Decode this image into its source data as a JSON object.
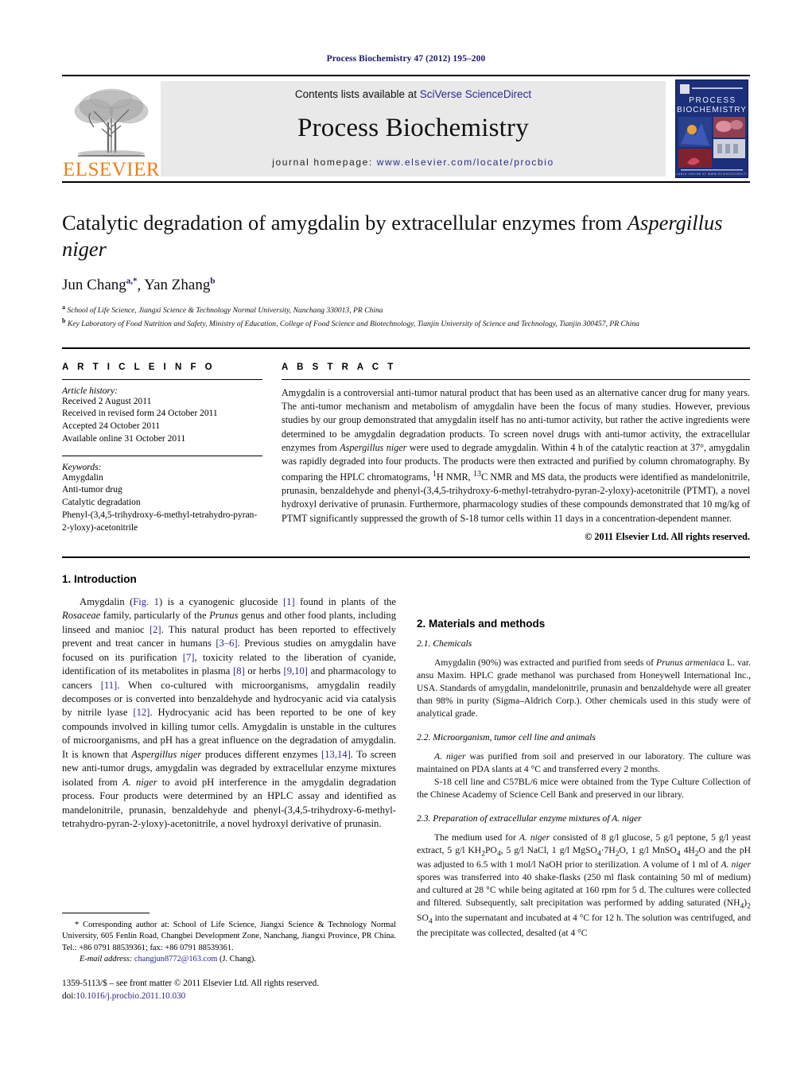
{
  "running_head": "Process Biochemistry 47 (2012) 195–200",
  "masthead": {
    "contents_prefix": "Contents lists available at ",
    "contents_link": "SciVerse ScienceDirect",
    "journal_title": "Process Biochemistry",
    "homepage_prefix": "journal homepage: ",
    "homepage_url": "www.elsevier.com/locate/procbio",
    "publisher_wordmark": "ELSEVIER",
    "publisher_logo_icon": "elsevier-tree-icon",
    "cover_thumb_icon": "journal-cover-thumbnail",
    "cover_title_line1": "PROCESS",
    "cover_title_line2": "BIOCHEMISTRY"
  },
  "article": {
    "title_part1": "Catalytic degradation of amygdalin by extracellular enzymes from ",
    "title_italic": "Aspergillus niger",
    "authors": [
      {
        "name": "Jun Chang",
        "marks": "a,*"
      },
      {
        "name": "Yan Zhang",
        "marks": "b"
      }
    ],
    "affiliations": [
      {
        "mark": "a",
        "text": "School of Life Science, Jiangxi Science & Technology Normal University, Nanchang 330013, PR China"
      },
      {
        "mark": "b",
        "text": "Key Laboratory of Food Nutrition and Safety, Ministry of Education, College of Food Science and Biotechnology, Tianjin University of Science and Technology, Tianjin 300457, PR China"
      }
    ]
  },
  "article_info": {
    "heading": "A R T I C L E  I N F O",
    "history_label": "Article history:",
    "history": [
      "Received 2 August 2011",
      "Received in revised form 24 October 2011",
      "Accepted 24 October 2011",
      "Available online 31 October 2011"
    ],
    "keywords_label": "Keywords:",
    "keywords": [
      "Amygdalin",
      "Anti-tumor drug",
      "Catalytic degradation",
      "Phenyl-(3,4,5-trihydroxy-6-methyl-tetrahydro-pyran-2-yloxy)-acetonitrile"
    ]
  },
  "abstract": {
    "heading": "A B S T R A C T",
    "p1_a": "Amygdalin is a controversial anti-tumor natural product that has been used as an alternative cancer drug for many years. The anti-tumor mechanism and metabolism of amygdalin have been the focus of many studies. However, previous studies by our group demonstrated that amygdalin itself has no anti-tumor activity, but rather the active ingredients were determined to be amygdalin degradation products. To screen novel drugs with anti-tumor activity, the extracellular enzymes from ",
    "p1_italic1": "Aspergillus niger",
    "p1_b": " were used to degrade amygdalin. Within 4 h of the catalytic reaction at 37°, amygdalin was rapidly degraded into four products. The products were then extracted and purified by column chromatography. By comparing the HPLC chromatograms, ",
    "p1_sup1": "1",
    "p1_c": "H NMR, ",
    "p1_sup2": "13",
    "p1_d": "C NMR and MS data, the products were identified as mandelonitrile, prunasin, benzaldehyde and phenyl-(3,4,5-trihydroxy-6-methyl-tetrahydro-pyran-2-yloxy)-acetonitrile (PTMT), a novel hydroxyl derivative of prunasin. Furthermore, pharmacology studies of these compounds demonstrated that 10 mg/kg of PTMT significantly suppressed the growth of S-18 tumor cells within 11 days in a concentration-dependent manner.",
    "copyright": "© 2011 Elsevier Ltd. All rights reserved."
  },
  "sections": {
    "introduction": {
      "number_title": "1.  Introduction",
      "p1_a": "Amygdalin (",
      "p1_figref": "Fig. 1",
      "p1_b": ") is a cyanogenic glucoside ",
      "p1_r1": "[1]",
      "p1_c": " found in plants of the ",
      "p1_i1": "Rosaceae",
      "p1_d": " family, particularly of the ",
      "p1_i2": "Prunus",
      "p1_e": " genus and other food plants, including linseed and manioc ",
      "p1_r2": "[2]",
      "p1_f": ". This natural product has been reported to effectively prevent and treat cancer in humans ",
      "p1_r3": "[3–6]",
      "p1_g": ". Previous studies on amygdalin have focused on its purification ",
      "p1_r4": "[7]",
      "p1_h": ", toxicity related to the liberation of cyanide, identification of its metabolites in plasma ",
      "p1_r5": "[8]",
      "p1_i": " or herbs ",
      "p1_r6": "[9,10]",
      "p1_j": " and pharmacology to cancers ",
      "p1_r7": "[11]",
      "p1_k": ". When co-cultured with microorganisms, amygdalin readily decomposes or is converted into benzaldehyde and hydrocyanic acid via catalysis by nitrile lyase ",
      "p1_r8": "[12]",
      "p1_l": ". Hydrocyanic acid has been reported to be one of key compounds involved in killing tumor cells. Amygdalin is unstable in the cultures of microorganisms, and pH has a great influence on the degradation of amygdalin. It is known that ",
      "p1_i3": "Aspergillus niger",
      "p1_m": " produces different enzymes ",
      "p1_r9": "[13,14]",
      "p1_n": ". To screen new anti-tumor drugs, amygdalin was degraded by extracellular enzyme mixtures isolated from ",
      "p1_i4": "A. niger",
      "p1_o": " to avoid pH interference in the amygdalin degradation process. Four products were determined by an HPLC assay and identified as mandelonitrile, prunasin, benzaldehyde and phenyl-(3,4,5-trihydroxy-6-methyl-tetrahydro-pyran-2-yloxy)-acetonitrile, a novel hydroxyl derivative of prunasin."
    },
    "materials": {
      "number_title": "2.  Materials and methods",
      "sub1_title": "2.1.  Chemicals",
      "sub1_a": "Amygdalin (90%) was extracted and purified from seeds of ",
      "sub1_i1": "Prunus armeniaca",
      "sub1_b": " L. var. ansu Maxim. HPLC grade methanol was purchased from Honeywell International Inc., USA. Standards of amygdalin, mandelonitrile, prunasin and benzaldehyde were all greater than 98% in purity (Sigma–Aldrich Corp.). Other chemicals used in this study were of analytical grade.",
      "sub2_title": "2.2.  Microorganism, tumor cell line and animals",
      "sub2_i1": "A. niger",
      "sub2_a": " was purified from soil and preserved in our laboratory. The culture was maintained on PDA slants at 4 °C and transferred every 2 months.",
      "sub2_b": "S-18 cell line and C57BL/6 mice were obtained from the Type Culture Collection of the Chinese Academy of Science Cell Bank and preserved in our library.",
      "sub3_title": "2.3.  Preparation of extracellular enzyme mixtures of A. niger",
      "sub3_a": "The medium used for ",
      "sub3_i1": "A. niger",
      "sub3_b": " consisted of 8 g/l glucose, 5 g/l peptone, 5 g/l yeast extract, 5 g/l KH",
      "sub3_sub1": "2",
      "sub3_c": "PO",
      "sub3_sub2": "4",
      "sub3_d": ", 5 g/l NaCl, 1 g/l MgSO",
      "sub3_sub3": "4",
      "sub3_e": "·7H",
      "sub3_sub4": "2",
      "sub3_f": "O, 1 g/l MnSO",
      "sub3_sub5": "4",
      "sub3_g": " 4H",
      "sub3_sub6": "2",
      "sub3_h": "O and the pH was adjusted to 6.5 with 1 mol/l NaOH prior to sterilization. A volume of 1 ml of ",
      "sub3_i2": "A. niger",
      "sub3_i": " spores was transferred into 40 shake-flasks (250 ml flask containing 50 ml of medium) and cultured at 28 °C while being agitated at 160 rpm for 5 d. The cultures were collected and filtered. Subsequently, salt precipitation was performed by adding saturated (NH",
      "sub3_sub7": "4",
      "sub3_j": ")",
      "sub3_sub8": "2",
      "sub3_k": " SO",
      "sub3_sub9": "4",
      "sub3_l": " into the supernatant and incubated at 4 °C for 12 h. The solution was centrifuged, and the precipitate was collected, desalted (at 4 °C"
    }
  },
  "footnote": {
    "star": "*",
    "corresponding": " Corresponding author at: School of Life Science, Jiangxi Science & Technology Normal University, 605 Fenlin Road, Changbei Development Zone, Nanchang, Jiangxi Province, PR China. Tel.: +86 0791 88539361; fax: +86 0791 88539361.",
    "email_label": "E-mail address:",
    "email_addr": " changjun8772@163.com",
    "email_suffix": " (J. Chang).",
    "imprint_line1": "1359-5113/$ – see front matter © 2011 Elsevier Ltd. All rights reserved.",
    "imprint_doi_label": "doi:",
    "imprint_doi": "10.1016/j.procbio.2011.10.030"
  },
  "colors": {
    "link": "#2a2a8c",
    "elsevier_orange": "#F07F13",
    "masthead_bg": "#e9e9e9",
    "cover_blue": "#1b2f7a"
  }
}
